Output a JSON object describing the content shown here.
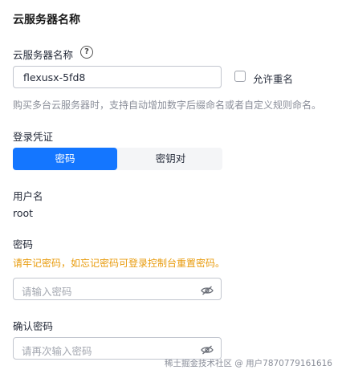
{
  "section": {
    "title": "云服务器名称"
  },
  "name_field": {
    "label": "云服务器名称",
    "help_icon": "question-circle-icon",
    "value": "flexusx-5fd8",
    "allow_duplicate_label": "允许重名",
    "allow_duplicate_checked": false,
    "hint": "购买多台云服务器时，支持自动增加数字后缀命名或者自定义规则命名。"
  },
  "credential": {
    "label": "登录凭证",
    "options": [
      "密码",
      "密钥对"
    ],
    "selected": "密码"
  },
  "username": {
    "label": "用户名",
    "value": "root"
  },
  "password": {
    "label": "密码",
    "warning": "请牢记密码，如忘记密码可登录控制台重置密码。",
    "placeholder": "请输入密码",
    "toggle_icon": "eye-slash-icon"
  },
  "confirm_password": {
    "label": "确认密码",
    "placeholder": "请再次输入密码",
    "toggle_icon": "eye-slash-icon"
  },
  "watermark": "稀土掘金技术社区 @ 用户7870779161616",
  "colors": {
    "accent": "#1476ff",
    "warning": "#e89b0c",
    "hint": "#8a8e99",
    "border": "#c2c6cf"
  }
}
